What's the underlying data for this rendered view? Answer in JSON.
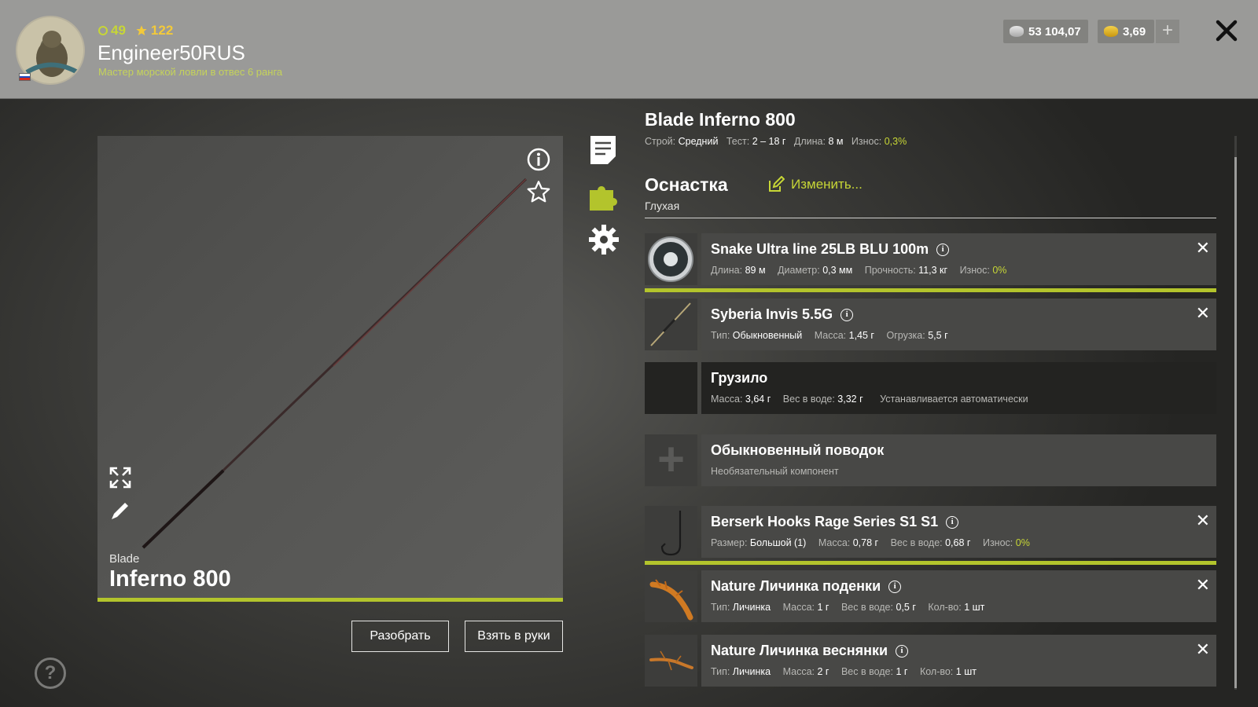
{
  "header": {
    "level": "49",
    "rank_points": "122",
    "username": "Engineer50RUS",
    "rank_title": "Мастер морской ловли в отвес 6 ранга",
    "silver": "53 104,07",
    "gold": "3,69",
    "plus_label": "+"
  },
  "rod": {
    "brand": "Blade",
    "model": "Inferno 800",
    "title": "Blade Inferno 800",
    "specs": {
      "stroy_label": "Строй:",
      "stroy": "Средний",
      "test_label": "Тест:",
      "test": "2 – 18 г",
      "length_label": "Длина:",
      "length": "8 м",
      "wear_label": "Износ:",
      "wear": "0,3%"
    }
  },
  "actions": {
    "disassemble": "Разобрать",
    "take_in_hands": "Взять в руки",
    "help": "?"
  },
  "tackle": {
    "title": "Оснастка",
    "edit": "Изменить...",
    "subtitle": "Глухая"
  },
  "components": [
    {
      "name": "Snake Ultra line 25LB BLU 100m",
      "m": [
        [
          "Длина:",
          "89 м"
        ],
        [
          "Диаметр:",
          "0,3 мм"
        ],
        [
          "Прочность:",
          "11,3 кг"
        ]
      ],
      "wear_label": "Износ:",
      "wear": "0%"
    },
    {
      "name": "Syberia Invis 5.5G",
      "m": [
        [
          "Тип:",
          "Обыкновенный"
        ],
        [
          "Масса:",
          "1,45 г"
        ],
        [
          "Огрузка:",
          "5,5 г"
        ]
      ]
    },
    {
      "name": "Грузило",
      "m": [
        [
          "Масса:",
          "3,64 г"
        ],
        [
          "Вес в воде:",
          "3,32 г"
        ]
      ],
      "note": "Устанавливается автоматически"
    },
    {
      "name": "Обыкновенный поводок",
      "note": "Необязательный компонент"
    },
    {
      "name": "Berserk Hooks Rage Series S1 S1",
      "m": [
        [
          "Размер:",
          "Большой (1)"
        ],
        [
          "Масса:",
          "0,78 г"
        ],
        [
          "Вес в воде:",
          "0,68 г"
        ]
      ],
      "wear_label": "Износ:",
      "wear": "0%"
    },
    {
      "name": "Nature Личинка поденки",
      "m": [
        [
          "Тип:",
          "Личинка"
        ],
        [
          "Масса:",
          "1 г"
        ],
        [
          "Вес в воде:",
          "0,5 г"
        ],
        [
          "Кол-во:",
          "1 шт"
        ]
      ]
    },
    {
      "name": "Nature Личинка веснянки",
      "m": [
        [
          "Тип:",
          "Личинка"
        ],
        [
          "Масса:",
          "2 г"
        ],
        [
          "Вес в воде:",
          "1 г"
        ],
        [
          "Кол-во:",
          "1 шт"
        ]
      ]
    }
  ],
  "colors": {
    "accent": "#b3c42c",
    "gold": "#f2c93a",
    "header_bg": "#9a9a98"
  },
  "icons": {
    "close": "close-icon",
    "info": "info-icon",
    "star": "star-icon",
    "expand": "expand-icon",
    "pencil": "pencil-icon",
    "document": "document-icon",
    "puzzle": "puzzle-icon",
    "gear": "gear-icon",
    "edit": "edit-icon"
  }
}
